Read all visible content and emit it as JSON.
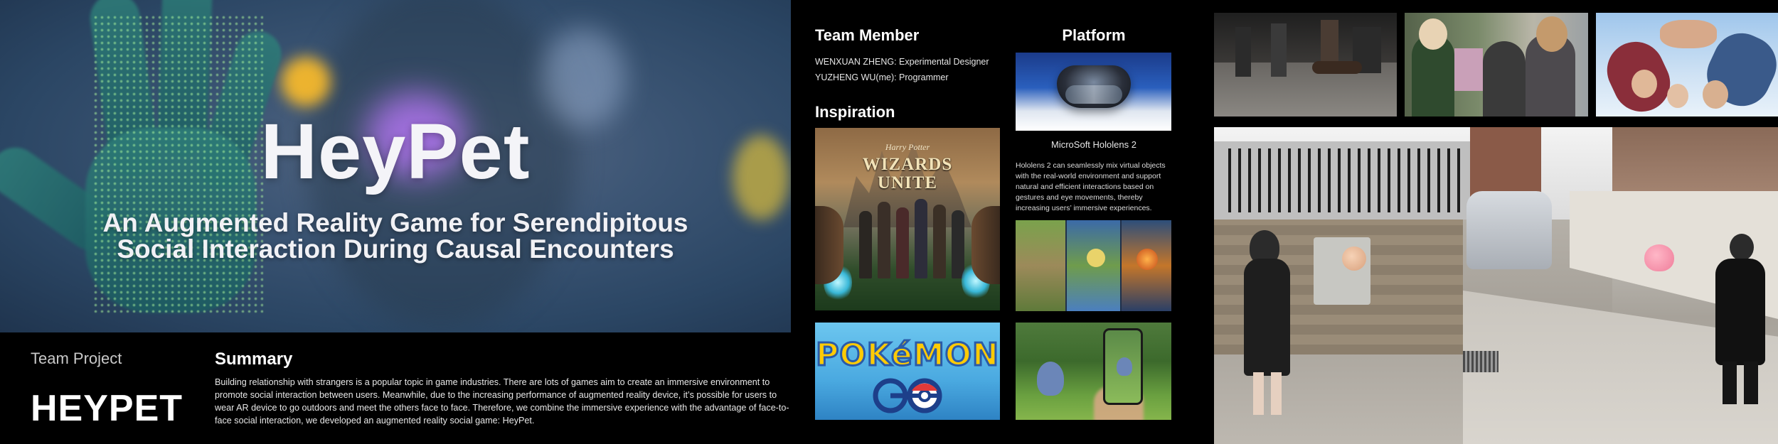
{
  "hero": {
    "title": "HeyPet",
    "subtitle_line1": "An Augmented Reality Game for Serendipitous",
    "subtitle_line2": "Social Interaction During Causal Encounters"
  },
  "project": {
    "label": "Team Project",
    "name": "HEYPET"
  },
  "summary": {
    "heading": "Summary",
    "text": "Building relationship with strangers is a popular topic in game industries.  There are lots of games aim to create an immersive environment to promote social interaction between users.  Meanwhile, due to the increasing performance of augmented reality device, it’s possible for users to wear AR device to go outdoors and meet the others face to face.  Therefore, we combine the immersive experience with the advantage of face-to-face social interaction, we developed an augmented reality social game: HeyPet."
  },
  "team": {
    "heading": "Team Member",
    "members": [
      "WENXUAN ZHENG: Experimental Designer",
      "YUZHENG WU(me): Programmer"
    ]
  },
  "inspiration": {
    "heading": "Inspiration",
    "hp_logo_top": "Harry Potter",
    "hp_logo_line1": "WIZARDS",
    "hp_logo_line2": "UNITE",
    "pokemon_word": "POKéMON"
  },
  "platform": {
    "heading": "Platform",
    "device_caption": "MicroSoft Hololens 2",
    "description": "Hololens 2 can seamlessly mix virtual objects with the real-world environment and support natural and efficient interactions based on gestures and eye movements, thereby increasing users’ immersive experiences."
  },
  "colors": {
    "background": "#000000",
    "pokemon_yellow": "#ffcb05",
    "pokemon_blue": "#2a5ba8"
  }
}
